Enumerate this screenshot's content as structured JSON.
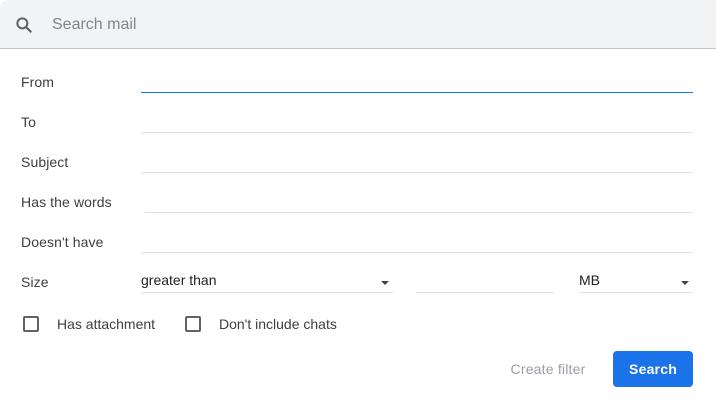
{
  "search": {
    "placeholder": "Search mail",
    "icon": "search-icon"
  },
  "form": {
    "from": {
      "label": "From",
      "value": ""
    },
    "to": {
      "label": "To",
      "value": ""
    },
    "subject": {
      "label": "Subject",
      "value": ""
    },
    "has_words": {
      "label": "Has the words",
      "value": ""
    },
    "doesnt_have": {
      "label": "Doesn't have",
      "value": ""
    },
    "size": {
      "label": "Size",
      "comparison": "greater than",
      "amount": "",
      "unit": "MB"
    },
    "has_attachment": {
      "label": "Has attachment",
      "checked": false
    },
    "dont_include_chats": {
      "label": "Don't include chats",
      "checked": false
    }
  },
  "actions": {
    "create_filter": "Create filter",
    "search": "Search"
  },
  "colors": {
    "accent": "#1a73e8",
    "searchbar_bg": "#f1f3f4",
    "disabled_text": "#9aa0a6"
  }
}
